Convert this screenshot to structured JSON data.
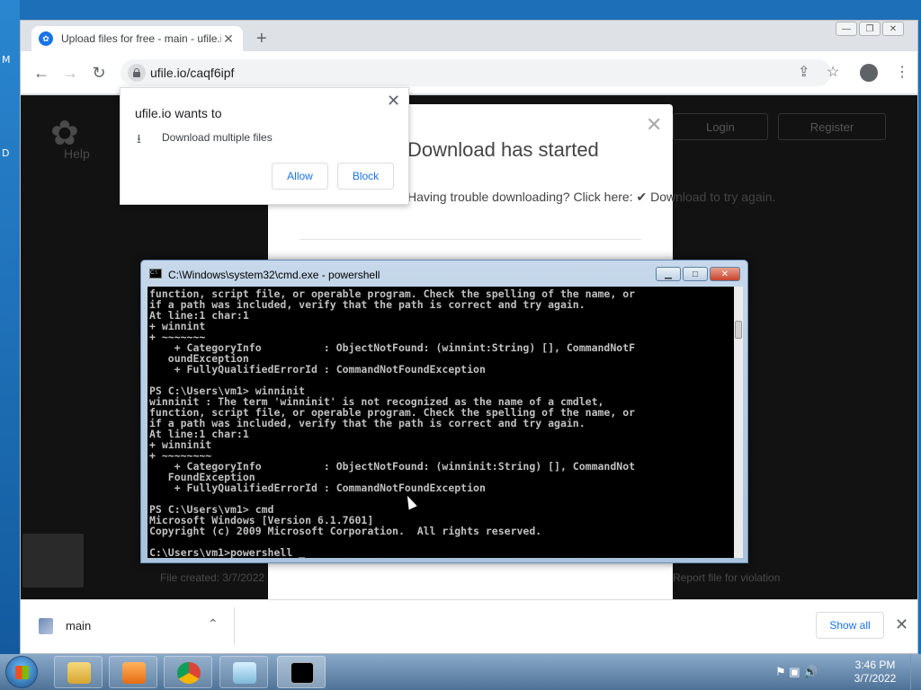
{
  "browser": {
    "tab_title": "Upload files for free - main - ufile.io",
    "url": "ufile.io/caqf6ipf"
  },
  "site": {
    "help": "Help",
    "login": "Login",
    "register": "Register",
    "file_created": "File created: 3/7/2022",
    "report": "Report file for violation"
  },
  "modal": {
    "title": "Download has started",
    "subtitle_prefix": "Having trouble downloading? Click here:",
    "subtitle_link": "✔ Download to try again."
  },
  "permission": {
    "title": "ufile.io wants to",
    "item": "Download multiple files",
    "allow": "Allow",
    "block": "Block"
  },
  "download_bar": {
    "file_name": "main",
    "show_all": "Show all"
  },
  "cmd": {
    "title": "C:\\Windows\\system32\\cmd.exe - powershell",
    "lines": "function, script file, or operable program. Check the spelling of the name, or\nif a path was included, verify that the path is correct and try again.\nAt line:1 char:1\n+ winnint\n+ ~~~~~~~\n    + CategoryInfo          : ObjectNotFound: (winnint:String) [], CommandNotF\n   oundException\n    + FullyQualifiedErrorId : CommandNotFoundException\n\nPS C:\\Users\\vm1> winninit\nwinninit : The term 'winninit' is not recognized as the name of a cmdlet,\nfunction, script file, or operable program. Check the spelling of the name, or\nif a path was included, verify that the path is correct and try again.\nAt line:1 char:1\n+ winninit\n+ ~~~~~~~~\n    + CategoryInfo          : ObjectNotFound: (winninit:String) [], CommandNot\n   FoundException\n    + FullyQualifiedErrorId : CommandNotFoundException\n\nPS C:\\Users\\vm1> cmd\nMicrosoft Windows [Version 6.1.7601]\nCopyright (c) 2009 Microsoft Corporation.  All rights reserved.\n\nC:\\Users\\vm1>powershell _"
  },
  "taskbar": {
    "time": "3:46 PM",
    "date": "3/7/2022"
  },
  "desktop": {
    "letter1": "M",
    "letter2": "D"
  },
  "colors": {
    "desktop": "#1d6fb8",
    "cmd_bg": "#000000",
    "link": "#1a73e8"
  }
}
